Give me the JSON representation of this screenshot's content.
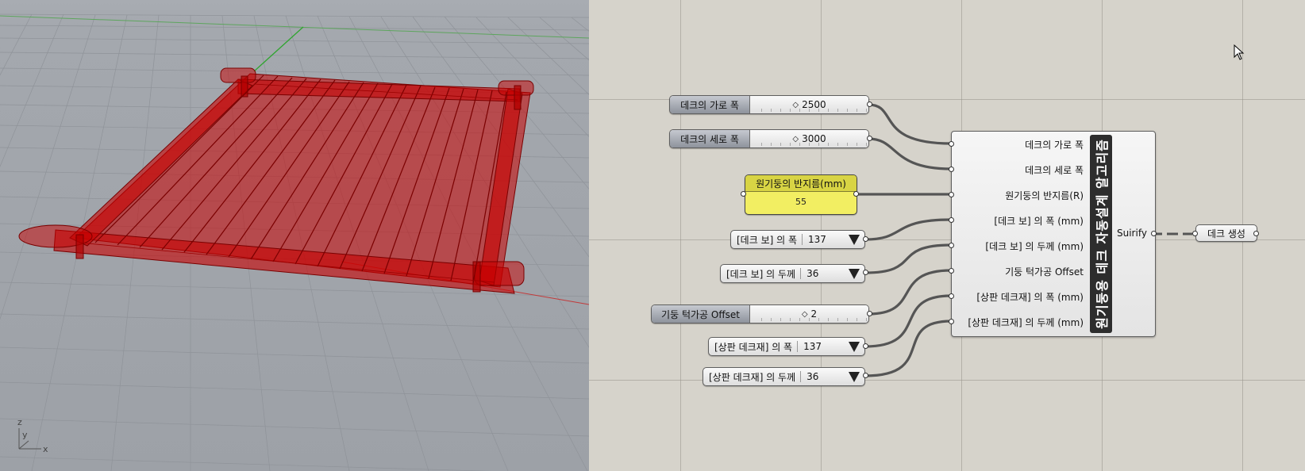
{
  "viewport": {
    "axis_labels": {
      "x": "x",
      "y": "y",
      "z": "z"
    }
  },
  "canvas": {
    "sliders": [
      {
        "label": "데크의 가로 폭",
        "value": "2500"
      },
      {
        "label": "데크의 세로 폭",
        "value": "3000"
      },
      {
        "label": "기둥 턱가공 Offset",
        "value": "2"
      }
    ],
    "panel": {
      "title": "원기둥의 반지름(mm)",
      "value": "55"
    },
    "value_lists": [
      {
        "label": "[데크 보] 의 폭",
        "value": "137"
      },
      {
        "label": "[데크 보] 의 두께",
        "value": "36"
      },
      {
        "label": "[상판 데크재] 의 폭",
        "value": "137"
      },
      {
        "label": "[상판 데크재] 의 두께",
        "value": "36"
      }
    ],
    "cluster": {
      "name": "원기둥용 데크 자동설계 알고리즘",
      "inputs": [
        "데크의 가로 폭",
        "데크의 세로 폭",
        "원기둥의 반지름(R)",
        "[데크 보] 의 폭 (mm)",
        "[데크 보] 의 두께 (mm)",
        "기둥 턱가공 Offset",
        "[상판 데크재] 의 폭 (mm)",
        "[상판 데크재] 의 두께 (mm)"
      ],
      "output": "Suirify"
    },
    "output_node": {
      "label": "데크 생성"
    }
  },
  "colors": {
    "deck_red": "#c80000",
    "panel_yellow": "#f2ee62",
    "cluster_name_bg": "#2d2d2d"
  }
}
